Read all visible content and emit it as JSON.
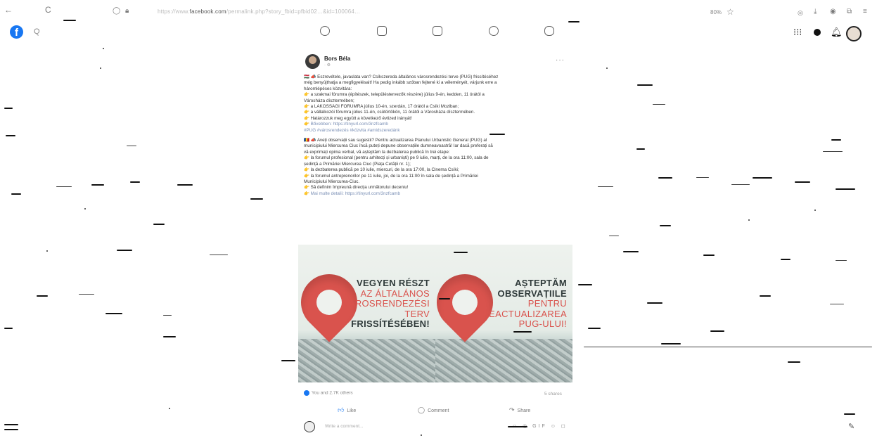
{
  "browser": {
    "url_domain": "facebook.com",
    "zoom": "80%",
    "back_glyph": "←",
    "reload_glyph": "C"
  },
  "topbar": {
    "logo_glyph": "f",
    "search_glyph": "Q"
  },
  "post": {
    "author": "Bors Béla",
    "meta": "· ⚙",
    "more": "···",
    "hu_lines": [
      "🇭🇺 📣 Észrevétele, javaslata van? Csíkszereda általános városrendezési terve (PUG) frissítéséhez",
      "még benyújthatja a megfigyelésait! Ha pedig inkább szóban fejtené ki a véleményét, várjunk erre a",
      "háromlépéses közvitára:",
      "👉 a szakmai fórumra (építészek, településtervezők részére) július 9-én, kedden, 11 órától a",
      "Városháza dísztermében;",
      "👉 a LAKOSSÁGI FÓRUMRA július 10-én, szerdán, 17 órától a Csíki Moziban;",
      "👉 a vállalkozói fórumra július 11-én, csütörtökön, 11 órától a Városháza dísztermében.",
      "👉 Határozzuk meg együtt a következő évtized irányát!",
      "👉 Bővebben: https://tinyurl.com/3nzfcamb"
    ],
    "hu_tags": "#PUG #városrendezés #közvita #amidszeredánk",
    "ro_lines": [
      "🇷🇴 📣 Aveți observații sau sugestii? Pentru actualizarea Planului Urbanistic General (PUG) al",
      "municipiului Miercurea Ciuc încă puteți depune observațiile dumneavoastră! Iar dacă preferați să",
      "vă exprimați opinia verbal, vă așteptăm la dezbaterea publică în trei etape:",
      "👉 la forumul profesional (pentru arhitecți și urbaniști) pe 9 iulie, marți, de la ora 11:00, sala de",
      "ședință a Primăriei Miercurea Ciuc (Piața Cetății nr. 1);",
      "👉 la dezbaterea publică pe 10 iulie, miercuri, de la ora 17:00, la Cinema Csíki;",
      "👉 la forumul antreprenorilor pe 11 iulie, joi, de la ora 11:00 în sala de ședință a Primăriei",
      "Municipiului Miercurea-Ciuc.",
      "👉 Să definim împreună direcția următorului deceniu!",
      "👉 Mai multe detalii: https://tinyurl.com/3nzfcamb"
    ],
    "image_left": {
      "line1": "VEGYEN RÉSZT",
      "line2": "AZ ÁLTALÁNOS",
      "line3": "VÁROSRENDEZÉSI",
      "line4": "TERV",
      "line5": "FRISSÍTÉSÉBEN!"
    },
    "image_right": {
      "line1": "AȘTEPTĂM",
      "line2": "OBSERVAȚIILE",
      "line3": "PENTRU",
      "line4": "REACTUALIZAREA",
      "line5": "PUG-ULUI!"
    },
    "reactions": "You and 2.7K others",
    "shares": "5 shares",
    "actions": {
      "like": "Like",
      "comment": "Comment",
      "share": "Share"
    },
    "comment_placeholder": "Write a comment...",
    "comment_emojis": "☺ ◎ GIF ☺ ◻"
  },
  "colors": {
    "facebook_blue": "#1877f2",
    "pin_red": "#d9534d",
    "text_dark": "#2f3a3a"
  },
  "icons": {
    "home": "home-icon",
    "watch": "video-icon",
    "marketplace": "store-icon",
    "groups": "groups-icon",
    "gaming": "gaming-icon",
    "menu": "grid-menu-icon",
    "messenger": "messenger-icon",
    "notifications": "bell-icon",
    "edit": "compose-icon"
  }
}
